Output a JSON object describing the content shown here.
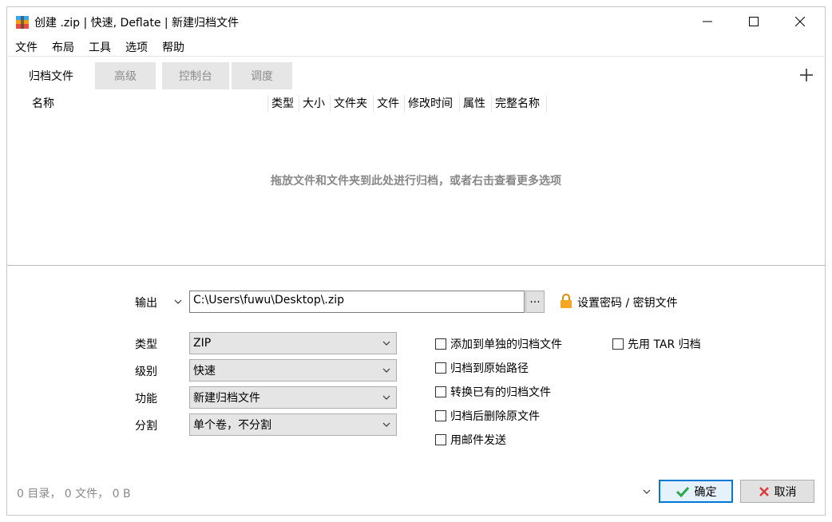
{
  "window": {
    "title": "创建 .zip | 快速, Deflate | 新建归档文件"
  },
  "menu": [
    "文件",
    "布局",
    "工具",
    "选项",
    "帮助"
  ],
  "tabs": [
    {
      "label": "归档文件",
      "active": true
    },
    {
      "label": "高级",
      "active": false
    },
    {
      "label": "控制台",
      "active": false
    },
    {
      "label": "调度",
      "active": false
    }
  ],
  "columns": [
    "名称",
    "类型",
    "大小",
    "文件夹",
    "文件",
    "修改时间",
    "属性",
    "完整名称"
  ],
  "drop_hint": "拖放文件和文件夹到此处进行归档，或者右击查看更多选项",
  "output": {
    "label": "输出",
    "value": "C:\\Users\\fuwu\\Desktop\\.zip",
    "browse": "...",
    "password_link": "设置密码 / 密钥文件"
  },
  "options": {
    "type": {
      "label": "类型",
      "value": "ZIP"
    },
    "level": {
      "label": "级别",
      "value": "快速"
    },
    "function": {
      "label": "功能",
      "value": "新建归档文件"
    },
    "split": {
      "label": "分割",
      "value": "单个卷，不分割"
    }
  },
  "checkboxes": {
    "separate": "添加到单独的归档文件",
    "tar_first": "先用 TAR 归档",
    "original_path": "归档到原始路径",
    "convert": "转换已有的归档文件",
    "delete_after": "归档后删除原文件",
    "email": "用邮件发送"
  },
  "status": "0 目录， 0 文件， 0 B",
  "buttons": {
    "ok": "确定",
    "cancel": "取消"
  },
  "colors": {
    "accent": "#0078d7",
    "ok_icon": "#2aa84a",
    "cancel_icon": "#e03a3a",
    "lock": "#f5a623"
  }
}
